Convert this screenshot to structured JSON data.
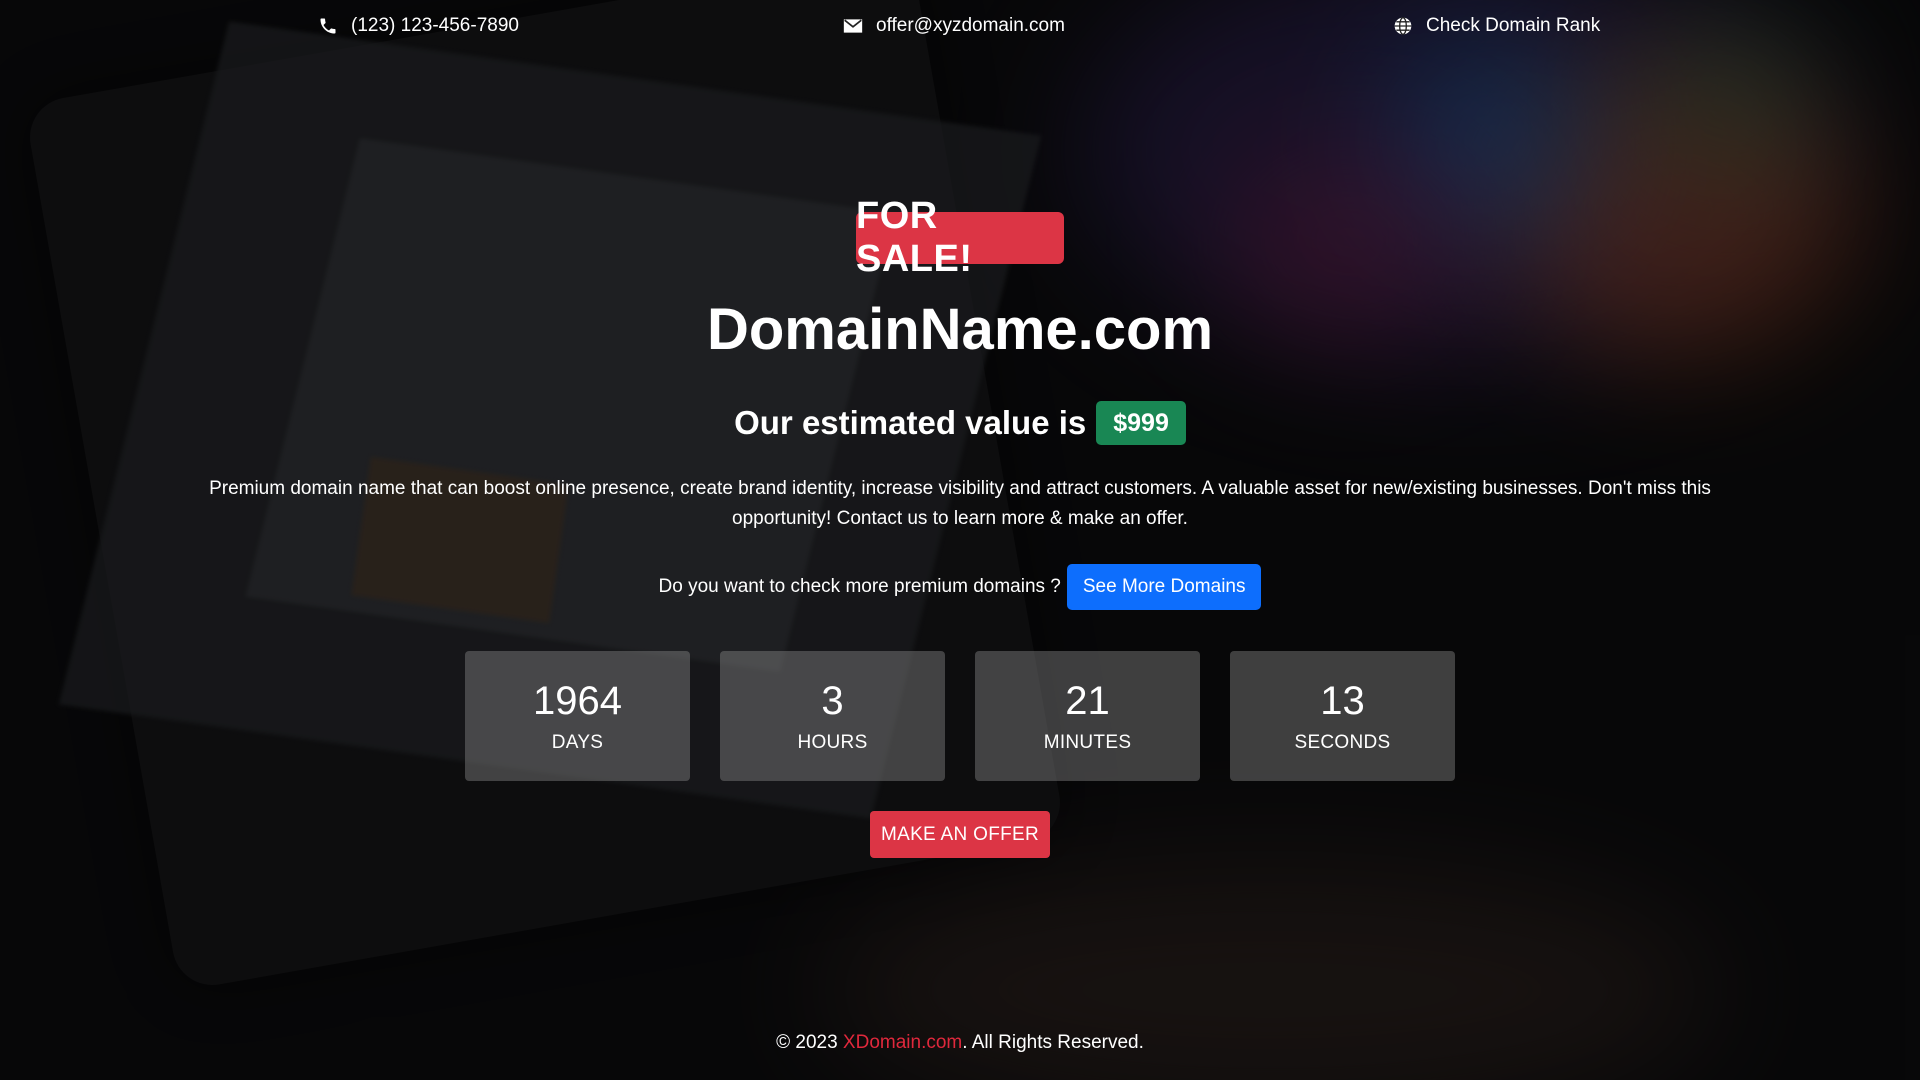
{
  "topbar": {
    "phone": "(123) 123-456-7890",
    "email": "offer@xyzdomain.com",
    "rank_label": "Check Domain Rank"
  },
  "hero": {
    "badge": "FOR SALE!",
    "domain": "DomainName.com",
    "value_prefix": "Our estimated value is",
    "value": "$999",
    "description": "Premium domain name that can boost online presence, create brand identity, increase visibility and attract customers. A valuable asset for new/existing businesses. Don't miss this opportunity! Contact us to learn more & make an offer.",
    "more_prompt": "Do you want to check more premium domains ?",
    "more_button": "See More Domains"
  },
  "countdown": {
    "days": {
      "value": "1964",
      "label": "DAYS"
    },
    "hours": {
      "value": "3",
      "label": "HOURS"
    },
    "minutes": {
      "value": "21",
      "label": "MINUTES"
    },
    "seconds": {
      "value": "13",
      "label": "SECONDS"
    }
  },
  "offer_button": "MAKE AN OFFER",
  "footer": {
    "prefix": "© 2023 ",
    "brand": "XDomain.com",
    "suffix": ". All Rights Reserved."
  },
  "colors": {
    "sale_red": "#dc3545",
    "value_green": "#198754",
    "button_blue": "#0d6efd",
    "brand_red": "#e0283c"
  },
  "icons": {
    "phone": "phone-icon",
    "email": "envelope-icon",
    "rank": "globe-icon"
  }
}
